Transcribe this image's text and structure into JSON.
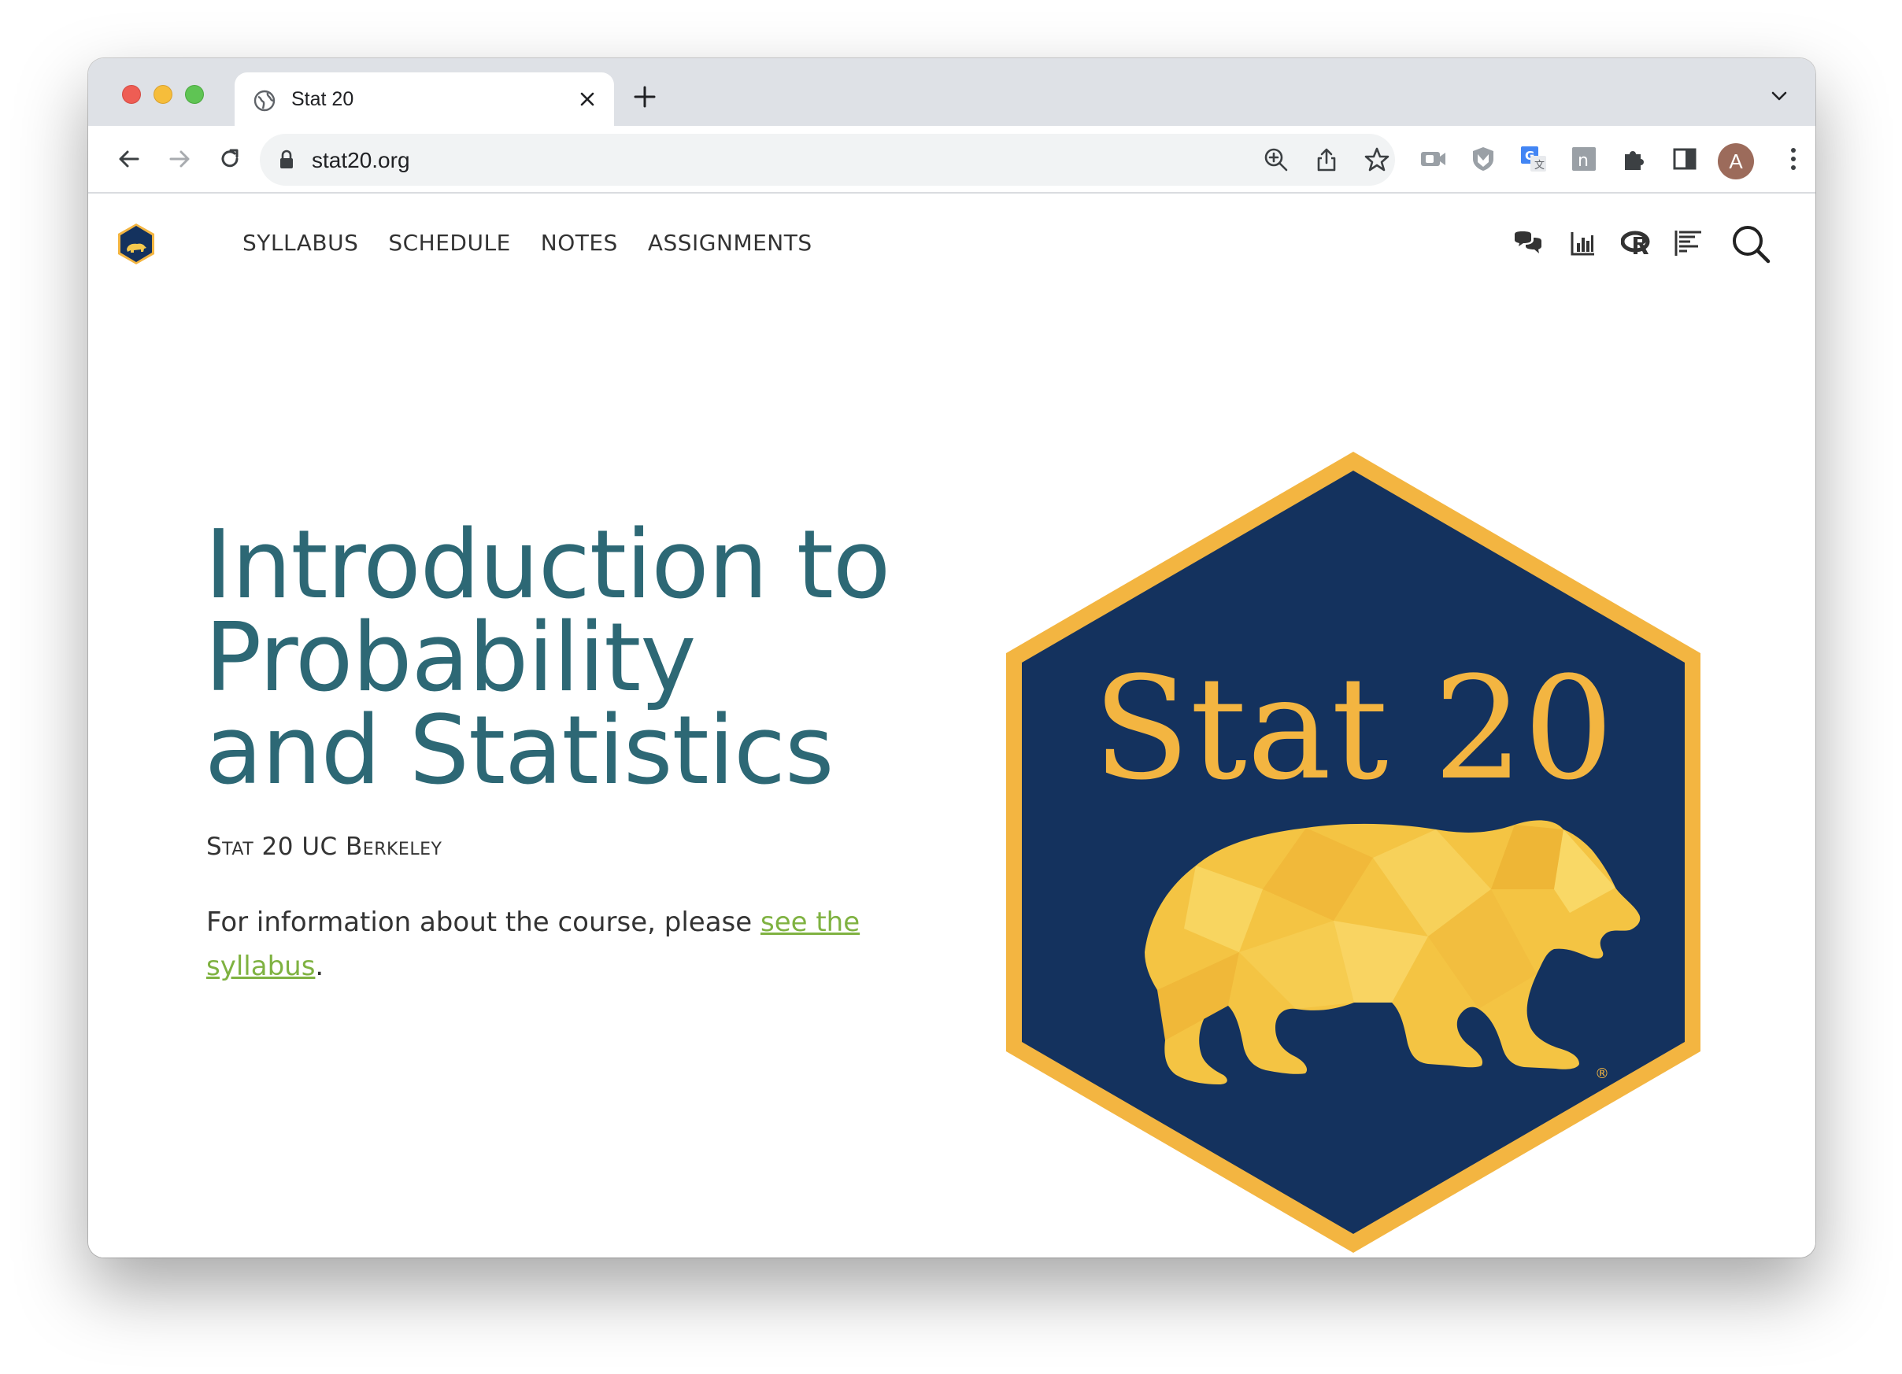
{
  "browser": {
    "tab": {
      "title": "Stat 20"
    },
    "address": {
      "url": "stat20.org"
    },
    "profile_initial": "A"
  },
  "site": {
    "nav": [
      {
        "label": "SYLLABUS"
      },
      {
        "label": "SCHEDULE"
      },
      {
        "label": "NOTES"
      },
      {
        "label": "ASSIGNMENTS"
      }
    ],
    "nav_icons": [
      "chat-icon",
      "bar-chart-icon",
      "r-logo-icon",
      "text-lines-icon",
      "search-icon"
    ]
  },
  "hero": {
    "title_lines": [
      "Introduction to",
      "Probability",
      "and Statistics"
    ],
    "subtitle": "Stat 20 UC Berkeley",
    "info_prefix": "For information about the course, please ",
    "info_link": "see the syllabus",
    "info_suffix": "."
  },
  "logo": {
    "text": "Stat 20",
    "trademark": "®"
  },
  "colors": {
    "heading": "#2d6875",
    "link": "#7fb241",
    "hex_navy": "#14325e",
    "hex_gold": "#f3b541"
  }
}
